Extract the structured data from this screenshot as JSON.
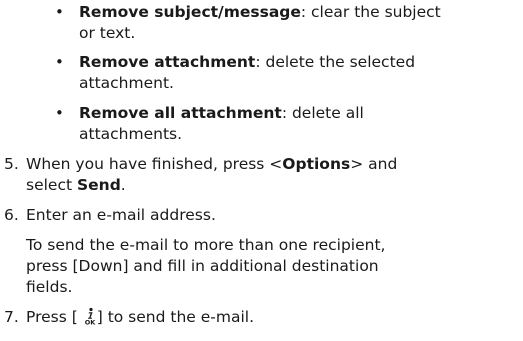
{
  "bullets": [
    {
      "bold": "Remove subject/message",
      "rest": ": clear the subject",
      "cont": "or text."
    },
    {
      "bold": "Remove attachment",
      "rest": ": delete the selected",
      "cont": "attachment."
    },
    {
      "bold": "Remove all attachment",
      "rest": ": delete all",
      "cont": "attachments."
    }
  ],
  "steps": [
    {
      "number": "5.",
      "line1_a": "When you have finished, press <",
      "line1_bold": "Options",
      "line1_b": "> and",
      "line2_a": "select ",
      "line2_bold": "Send",
      "line2_b": "."
    },
    {
      "number": "6.",
      "line1": "Enter an e-mail address.",
      "note1": "To send the e-mail to more than one recipient,",
      "note2": "press [Down] and fill in additional destination",
      "note3": "fields."
    },
    {
      "number": "7.",
      "line1_a": "Press [",
      "line1_b": "] to send the e-mail.",
      "icon": "ok-info-key-icon"
    }
  ]
}
